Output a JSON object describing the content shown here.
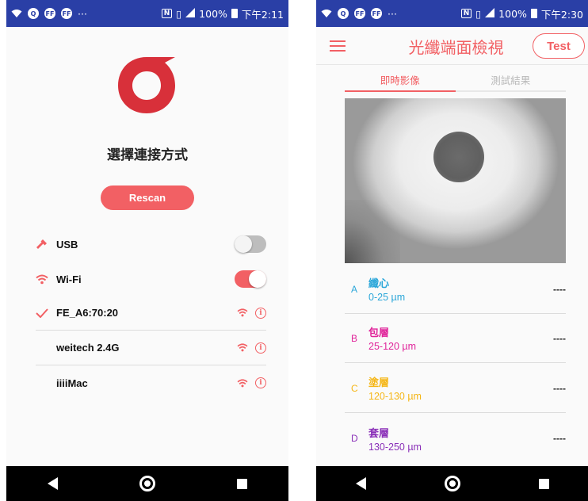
{
  "colors": {
    "accent": "#f26064",
    "logo": "#d8303a",
    "status_bar": "#2a3fa6",
    "layer_a": "#2aa6d9",
    "layer_b": "#e0249a",
    "layer_c": "#f5b616",
    "layer_d": "#8a30b8"
  },
  "screen1": {
    "status": {
      "overflow": "···",
      "icon1": "Q",
      "icon2": "FF",
      "icon3": "FF",
      "battery": "100%",
      "time": "下午2:11"
    },
    "title": "選擇連接方式",
    "rescan_label": "Rescan",
    "connections": [
      {
        "label": "USB",
        "icon": "usb-icon",
        "enabled": false
      },
      {
        "label": "Wi-Fi",
        "icon": "wifi-icon",
        "enabled": true
      }
    ],
    "networks": [
      {
        "ssid": "FE_A6:70:20",
        "connected": true
      },
      {
        "ssid": "weitech 2.4G",
        "connected": false
      },
      {
        "ssid": "iiiiMac",
        "connected": false
      }
    ],
    "info_glyph": "i"
  },
  "screen2": {
    "status": {
      "overflow": "···",
      "icon1": "Q",
      "icon2": "FF",
      "icon3": "FF",
      "battery": "100%",
      "time": "下午2:30"
    },
    "title": "光纖端面檢視",
    "test_label": "Test",
    "tabs": [
      {
        "label": "即時影像",
        "active": true
      },
      {
        "label": "測試結果",
        "active": false
      }
    ],
    "layers": [
      {
        "letter": "A",
        "name": "纖心",
        "range": "0-25 µm",
        "result": "----"
      },
      {
        "letter": "B",
        "name": "包層",
        "range": "25-120 µm",
        "result": "----"
      },
      {
        "letter": "C",
        "name": "塗層",
        "range": "120-130 µm",
        "result": "----"
      },
      {
        "letter": "D",
        "name": "套層",
        "range": "130-250 µm",
        "result": "----"
      }
    ]
  }
}
